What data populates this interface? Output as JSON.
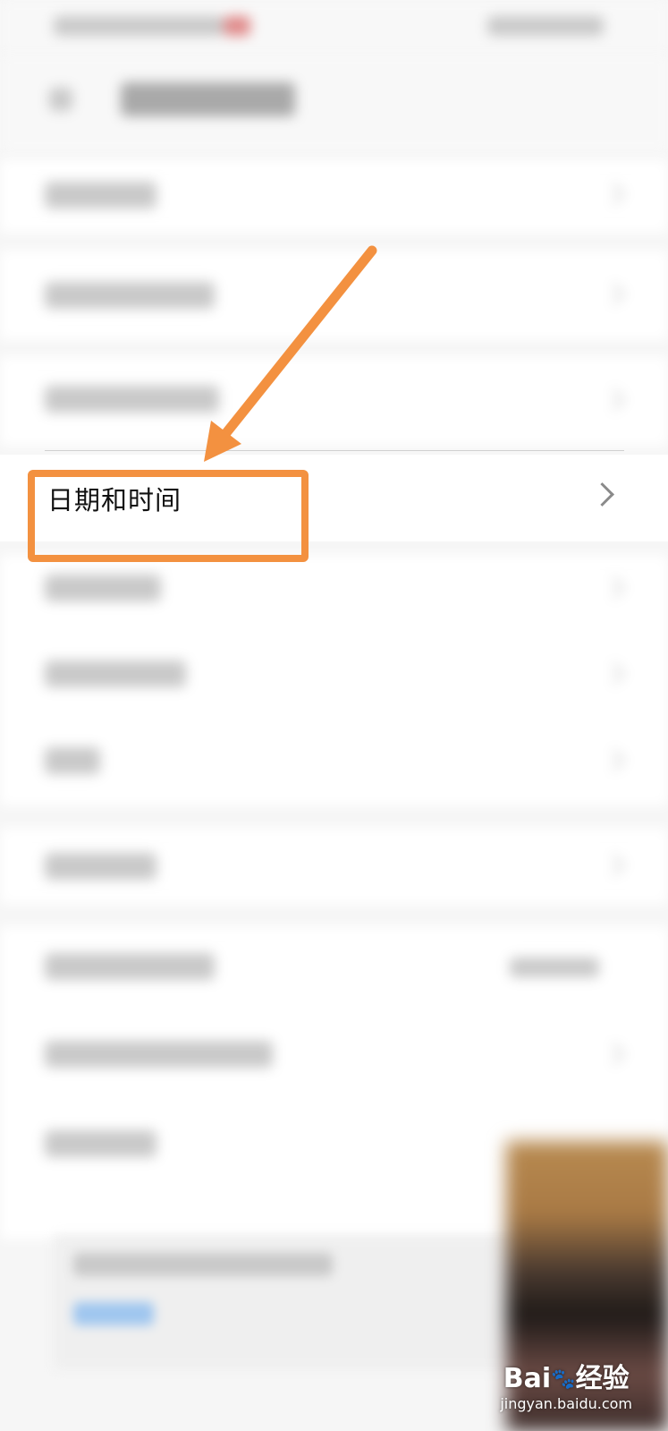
{
  "highlighted_item": {
    "label": "日期和时间",
    "chevron": "chevron-right-icon"
  },
  "watermark": {
    "logo_text_left": "Bai",
    "logo_text_right": "经验",
    "url": "jingyan.baidu.com",
    "icon": "paw-icon"
  },
  "annotation": {
    "color": "#f39140",
    "arrow": "arrow-down-left"
  },
  "colors": {
    "accent": "#f39140",
    "background": "#f6f6f6",
    "row": "#ffffff"
  }
}
